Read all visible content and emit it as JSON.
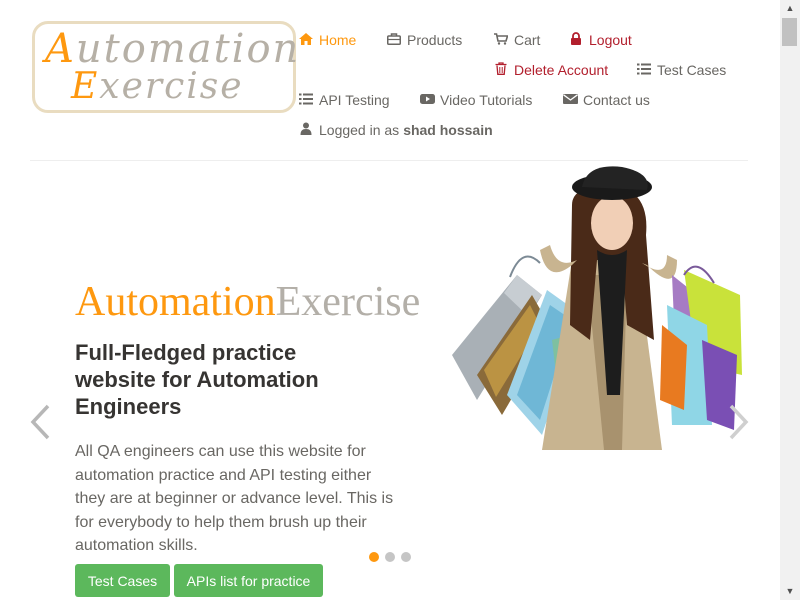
{
  "logo": {
    "line1_cap": "A",
    "line1_rest": "utomation",
    "line2_cap": "E",
    "line2_rest": "xercise"
  },
  "nav": {
    "home": "Home",
    "products": "Products",
    "cart": "Cart",
    "logout": "Logout",
    "delete_account": "Delete Account",
    "test_cases": "Test Cases",
    "api_testing": "API Testing",
    "video_tutorials": "Video Tutorials",
    "contact_us": "Contact us",
    "logged_in_prefix": "Logged in as",
    "username": "shad hossain"
  },
  "slider": {
    "brand_part1": "Automation",
    "brand_part2": "Exercise",
    "headline": "Full-Fledged practice website for Automation Engineers",
    "description": "All QA engineers can use this website for automation practice and API testing either they are at beginner or advance level. This is for everybody to help them brush up their automation skills.",
    "btn_test_cases": "Test Cases",
    "btn_api_list": "APIs list for practice",
    "active_slide": 1,
    "slide_count": 3
  },
  "colors": {
    "accent": "#fe980f",
    "danger": "#b21f2d",
    "button": "#5cb85c",
    "text": "#696763",
    "heading": "#363432"
  },
  "icons": [
    "home-icon",
    "briefcase-icon",
    "cart-icon",
    "lock-icon",
    "trash-icon",
    "list-icon",
    "youtube-icon",
    "envelope-icon",
    "user-icon",
    "chevron-left-icon",
    "chevron-right-icon"
  ]
}
